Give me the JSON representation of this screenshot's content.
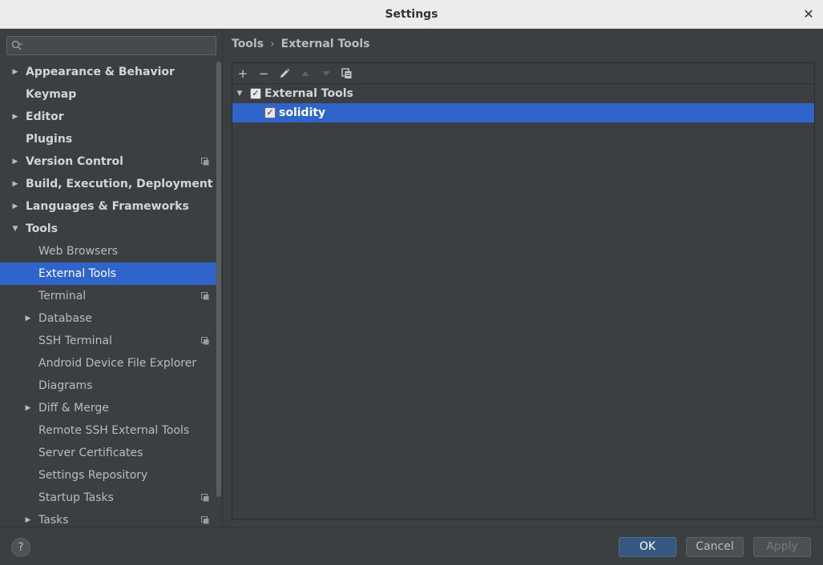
{
  "window": {
    "title": "Settings",
    "close_glyph": "✕"
  },
  "search": {
    "placeholder": "",
    "value": ""
  },
  "sidebar": {
    "items": [
      {
        "label": "Appearance & Behavior",
        "level": 0,
        "arrow": "right"
      },
      {
        "label": "Keymap",
        "level": 0,
        "arrow": "none"
      },
      {
        "label": "Editor",
        "level": 0,
        "arrow": "right"
      },
      {
        "label": "Plugins",
        "level": 0,
        "arrow": "none"
      },
      {
        "label": "Version Control",
        "level": 0,
        "arrow": "right",
        "project_icon": true
      },
      {
        "label": "Build, Execution, Deployment",
        "level": 0,
        "arrow": "right"
      },
      {
        "label": "Languages & Frameworks",
        "level": 0,
        "arrow": "right"
      },
      {
        "label": "Tools",
        "level": 0,
        "arrow": "down"
      },
      {
        "label": "Web Browsers",
        "level": 1,
        "arrow": "none"
      },
      {
        "label": "External Tools",
        "level": 1,
        "arrow": "none",
        "selected": true
      },
      {
        "label": "Terminal",
        "level": 1,
        "arrow": "none",
        "project_icon": true
      },
      {
        "label": "Database",
        "level": 1,
        "arrow": "right"
      },
      {
        "label": "SSH Terminal",
        "level": 1,
        "arrow": "none",
        "project_icon": true
      },
      {
        "label": "Android Device File Explorer",
        "level": 1,
        "arrow": "none"
      },
      {
        "label": "Diagrams",
        "level": 1,
        "arrow": "none"
      },
      {
        "label": "Diff & Merge",
        "level": 1,
        "arrow": "right"
      },
      {
        "label": "Remote SSH External Tools",
        "level": 1,
        "arrow": "none"
      },
      {
        "label": "Server Certificates",
        "level": 1,
        "arrow": "none"
      },
      {
        "label": "Settings Repository",
        "level": 1,
        "arrow": "none"
      },
      {
        "label": "Startup Tasks",
        "level": 1,
        "arrow": "none",
        "project_icon": true
      },
      {
        "label": "Tasks",
        "level": 1,
        "arrow": "right",
        "project_icon": true
      }
    ]
  },
  "breadcrumb": {
    "parent": "Tools",
    "separator": "›",
    "current": "External Tools"
  },
  "toolbar": {
    "add": "+",
    "remove": "−",
    "edit_icon": "pencil-icon",
    "move_up_icon": "arrow-up-icon",
    "move_down_icon": "arrow-down-icon",
    "copy_icon": "copy-icon"
  },
  "tools_tree": {
    "group": {
      "label": "External Tools",
      "checked": true,
      "expanded": true
    },
    "items": [
      {
        "label": "solidity",
        "checked": true,
        "selected": true
      }
    ]
  },
  "buttons": {
    "help": "?",
    "ok": "OK",
    "cancel": "Cancel",
    "apply": "Apply"
  },
  "colors": {
    "background": "#3c3f41",
    "selection": "#2f65ca",
    "titlebar": "#ececec",
    "primary_button": "#365880"
  }
}
